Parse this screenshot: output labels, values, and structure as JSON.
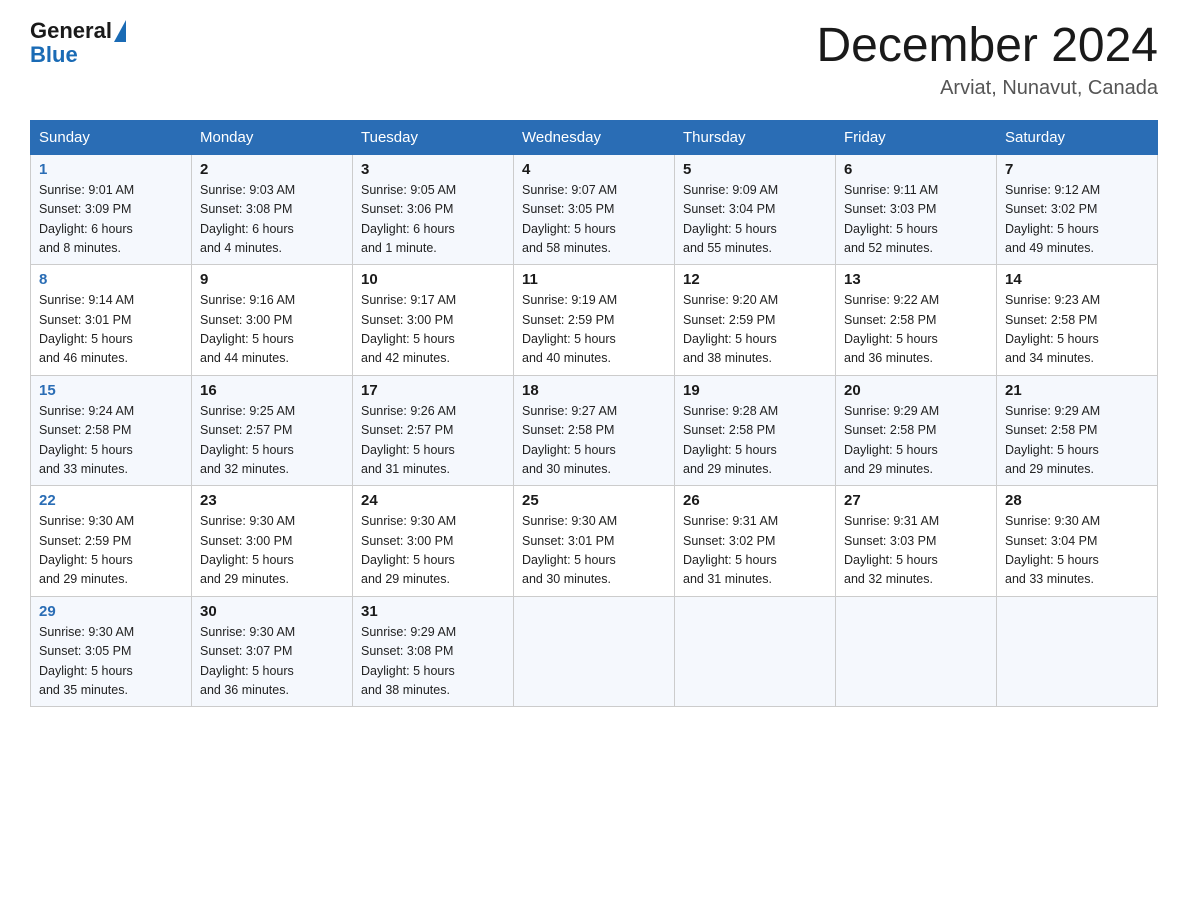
{
  "header": {
    "logo_general": "General",
    "logo_blue": "Blue",
    "month_year": "December 2024",
    "location": "Arviat, Nunavut, Canada"
  },
  "weekdays": [
    "Sunday",
    "Monday",
    "Tuesday",
    "Wednesday",
    "Thursday",
    "Friday",
    "Saturday"
  ],
  "weeks": [
    [
      {
        "day": "1",
        "info": "Sunrise: 9:01 AM\nSunset: 3:09 PM\nDaylight: 6 hours\nand 8 minutes."
      },
      {
        "day": "2",
        "info": "Sunrise: 9:03 AM\nSunset: 3:08 PM\nDaylight: 6 hours\nand 4 minutes."
      },
      {
        "day": "3",
        "info": "Sunrise: 9:05 AM\nSunset: 3:06 PM\nDaylight: 6 hours\nand 1 minute."
      },
      {
        "day": "4",
        "info": "Sunrise: 9:07 AM\nSunset: 3:05 PM\nDaylight: 5 hours\nand 58 minutes."
      },
      {
        "day": "5",
        "info": "Sunrise: 9:09 AM\nSunset: 3:04 PM\nDaylight: 5 hours\nand 55 minutes."
      },
      {
        "day": "6",
        "info": "Sunrise: 9:11 AM\nSunset: 3:03 PM\nDaylight: 5 hours\nand 52 minutes."
      },
      {
        "day": "7",
        "info": "Sunrise: 9:12 AM\nSunset: 3:02 PM\nDaylight: 5 hours\nand 49 minutes."
      }
    ],
    [
      {
        "day": "8",
        "info": "Sunrise: 9:14 AM\nSunset: 3:01 PM\nDaylight: 5 hours\nand 46 minutes."
      },
      {
        "day": "9",
        "info": "Sunrise: 9:16 AM\nSunset: 3:00 PM\nDaylight: 5 hours\nand 44 minutes."
      },
      {
        "day": "10",
        "info": "Sunrise: 9:17 AM\nSunset: 3:00 PM\nDaylight: 5 hours\nand 42 minutes."
      },
      {
        "day": "11",
        "info": "Sunrise: 9:19 AM\nSunset: 2:59 PM\nDaylight: 5 hours\nand 40 minutes."
      },
      {
        "day": "12",
        "info": "Sunrise: 9:20 AM\nSunset: 2:59 PM\nDaylight: 5 hours\nand 38 minutes."
      },
      {
        "day": "13",
        "info": "Sunrise: 9:22 AM\nSunset: 2:58 PM\nDaylight: 5 hours\nand 36 minutes."
      },
      {
        "day": "14",
        "info": "Sunrise: 9:23 AM\nSunset: 2:58 PM\nDaylight: 5 hours\nand 34 minutes."
      }
    ],
    [
      {
        "day": "15",
        "info": "Sunrise: 9:24 AM\nSunset: 2:58 PM\nDaylight: 5 hours\nand 33 minutes."
      },
      {
        "day": "16",
        "info": "Sunrise: 9:25 AM\nSunset: 2:57 PM\nDaylight: 5 hours\nand 32 minutes."
      },
      {
        "day": "17",
        "info": "Sunrise: 9:26 AM\nSunset: 2:57 PM\nDaylight: 5 hours\nand 31 minutes."
      },
      {
        "day": "18",
        "info": "Sunrise: 9:27 AM\nSunset: 2:58 PM\nDaylight: 5 hours\nand 30 minutes."
      },
      {
        "day": "19",
        "info": "Sunrise: 9:28 AM\nSunset: 2:58 PM\nDaylight: 5 hours\nand 29 minutes."
      },
      {
        "day": "20",
        "info": "Sunrise: 9:29 AM\nSunset: 2:58 PM\nDaylight: 5 hours\nand 29 minutes."
      },
      {
        "day": "21",
        "info": "Sunrise: 9:29 AM\nSunset: 2:58 PM\nDaylight: 5 hours\nand 29 minutes."
      }
    ],
    [
      {
        "day": "22",
        "info": "Sunrise: 9:30 AM\nSunset: 2:59 PM\nDaylight: 5 hours\nand 29 minutes."
      },
      {
        "day": "23",
        "info": "Sunrise: 9:30 AM\nSunset: 3:00 PM\nDaylight: 5 hours\nand 29 minutes."
      },
      {
        "day": "24",
        "info": "Sunrise: 9:30 AM\nSunset: 3:00 PM\nDaylight: 5 hours\nand 29 minutes."
      },
      {
        "day": "25",
        "info": "Sunrise: 9:30 AM\nSunset: 3:01 PM\nDaylight: 5 hours\nand 30 minutes."
      },
      {
        "day": "26",
        "info": "Sunrise: 9:31 AM\nSunset: 3:02 PM\nDaylight: 5 hours\nand 31 minutes."
      },
      {
        "day": "27",
        "info": "Sunrise: 9:31 AM\nSunset: 3:03 PM\nDaylight: 5 hours\nand 32 minutes."
      },
      {
        "day": "28",
        "info": "Sunrise: 9:30 AM\nSunset: 3:04 PM\nDaylight: 5 hours\nand 33 minutes."
      }
    ],
    [
      {
        "day": "29",
        "info": "Sunrise: 9:30 AM\nSunset: 3:05 PM\nDaylight: 5 hours\nand 35 minutes."
      },
      {
        "day": "30",
        "info": "Sunrise: 9:30 AM\nSunset: 3:07 PM\nDaylight: 5 hours\nand 36 minutes."
      },
      {
        "day": "31",
        "info": "Sunrise: 9:29 AM\nSunset: 3:08 PM\nDaylight: 5 hours\nand 38 minutes."
      },
      {
        "day": "",
        "info": ""
      },
      {
        "day": "",
        "info": ""
      },
      {
        "day": "",
        "info": ""
      },
      {
        "day": "",
        "info": ""
      }
    ]
  ]
}
